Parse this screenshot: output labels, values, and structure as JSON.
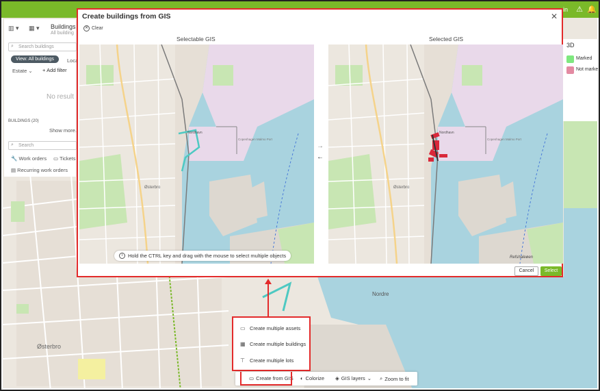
{
  "topbar": {
    "user_initial": "in",
    "icons": [
      "warning-icon",
      "bell-icon"
    ]
  },
  "left_panel": {
    "breadcrumb_title": "Buildings",
    "breadcrumb_sub": "All building",
    "search_placeholder": "Search buildings",
    "view_label": "View: All buildings",
    "location_tab": "Loca",
    "estate_filter": "Estate",
    "add_filter": "Add filter",
    "no_results": "No result",
    "count_label": "BUILDINGS (20)",
    "show_more": "Show more...",
    "search2_placeholder": "Search",
    "work_orders": "Work orders",
    "tickets": "Tickets",
    "recurring": "Recurring work orders"
  },
  "right_panel": {
    "title": "3D",
    "legend": [
      {
        "label": "Marked",
        "color": "#7fe87f"
      },
      {
        "label": "Not marke",
        "color": "#e38aa2"
      }
    ]
  },
  "modal": {
    "title": "Create buildings from GIS",
    "clear": "Clear",
    "left_label": "Selectable GIS",
    "right_label": "Selected GIS",
    "hint": "Hold the CTRL key and drag with the mouse to select multiple objects",
    "cancel": "Cancel",
    "select": "Select"
  },
  "map_labels": {
    "nordhavn": "Nordhavn",
    "copenhagen_malmo": "Copenhagen Malmo Port",
    "osterbro": "Østerbro",
    "refshaleoen": "Refshaleøen",
    "nordre": "Nordre"
  },
  "popup_menu": [
    {
      "label": "Create multiple assets",
      "icon": "calendar-icon"
    },
    {
      "label": "Create multiple buildings",
      "icon": "buildings-icon"
    },
    {
      "label": "Create multiple lots",
      "icon": "signpost-icon"
    }
  ],
  "toolbar": {
    "create_from_gis": "Create from GIS",
    "colorize": "Colorize",
    "gis_layers": "GIS layers",
    "zoom_to_fit": "Zoom to fit"
  },
  "colors": {
    "accent_green": "#7ab929",
    "highlight_red": "#e32a2a",
    "water": "#a9d3df",
    "land": "#ece7df",
    "park": "#c8e6b3",
    "industrial": "#e9d9ea"
  }
}
